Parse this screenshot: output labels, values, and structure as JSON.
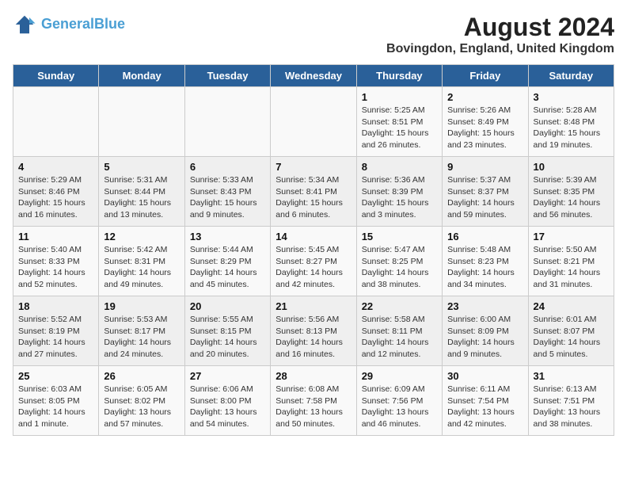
{
  "header": {
    "logo_line1": "General",
    "logo_line2": "Blue",
    "month": "August 2024",
    "location": "Bovingdon, England, United Kingdom"
  },
  "days_of_week": [
    "Sunday",
    "Monday",
    "Tuesday",
    "Wednesday",
    "Thursday",
    "Friday",
    "Saturday"
  ],
  "weeks": [
    [
      {
        "day": "",
        "content": ""
      },
      {
        "day": "",
        "content": ""
      },
      {
        "day": "",
        "content": ""
      },
      {
        "day": "",
        "content": ""
      },
      {
        "day": "1",
        "content": "Sunrise: 5:25 AM\nSunset: 8:51 PM\nDaylight: 15 hours\nand 26 minutes."
      },
      {
        "day": "2",
        "content": "Sunrise: 5:26 AM\nSunset: 8:49 PM\nDaylight: 15 hours\nand 23 minutes."
      },
      {
        "day": "3",
        "content": "Sunrise: 5:28 AM\nSunset: 8:48 PM\nDaylight: 15 hours\nand 19 minutes."
      }
    ],
    [
      {
        "day": "4",
        "content": "Sunrise: 5:29 AM\nSunset: 8:46 PM\nDaylight: 15 hours\nand 16 minutes."
      },
      {
        "day": "5",
        "content": "Sunrise: 5:31 AM\nSunset: 8:44 PM\nDaylight: 15 hours\nand 13 minutes."
      },
      {
        "day": "6",
        "content": "Sunrise: 5:33 AM\nSunset: 8:43 PM\nDaylight: 15 hours\nand 9 minutes."
      },
      {
        "day": "7",
        "content": "Sunrise: 5:34 AM\nSunset: 8:41 PM\nDaylight: 15 hours\nand 6 minutes."
      },
      {
        "day": "8",
        "content": "Sunrise: 5:36 AM\nSunset: 8:39 PM\nDaylight: 15 hours\nand 3 minutes."
      },
      {
        "day": "9",
        "content": "Sunrise: 5:37 AM\nSunset: 8:37 PM\nDaylight: 14 hours\nand 59 minutes."
      },
      {
        "day": "10",
        "content": "Sunrise: 5:39 AM\nSunset: 8:35 PM\nDaylight: 14 hours\nand 56 minutes."
      }
    ],
    [
      {
        "day": "11",
        "content": "Sunrise: 5:40 AM\nSunset: 8:33 PM\nDaylight: 14 hours\nand 52 minutes."
      },
      {
        "day": "12",
        "content": "Sunrise: 5:42 AM\nSunset: 8:31 PM\nDaylight: 14 hours\nand 49 minutes."
      },
      {
        "day": "13",
        "content": "Sunrise: 5:44 AM\nSunset: 8:29 PM\nDaylight: 14 hours\nand 45 minutes."
      },
      {
        "day": "14",
        "content": "Sunrise: 5:45 AM\nSunset: 8:27 PM\nDaylight: 14 hours\nand 42 minutes."
      },
      {
        "day": "15",
        "content": "Sunrise: 5:47 AM\nSunset: 8:25 PM\nDaylight: 14 hours\nand 38 minutes."
      },
      {
        "day": "16",
        "content": "Sunrise: 5:48 AM\nSunset: 8:23 PM\nDaylight: 14 hours\nand 34 minutes."
      },
      {
        "day": "17",
        "content": "Sunrise: 5:50 AM\nSunset: 8:21 PM\nDaylight: 14 hours\nand 31 minutes."
      }
    ],
    [
      {
        "day": "18",
        "content": "Sunrise: 5:52 AM\nSunset: 8:19 PM\nDaylight: 14 hours\nand 27 minutes."
      },
      {
        "day": "19",
        "content": "Sunrise: 5:53 AM\nSunset: 8:17 PM\nDaylight: 14 hours\nand 24 minutes."
      },
      {
        "day": "20",
        "content": "Sunrise: 5:55 AM\nSunset: 8:15 PM\nDaylight: 14 hours\nand 20 minutes."
      },
      {
        "day": "21",
        "content": "Sunrise: 5:56 AM\nSunset: 8:13 PM\nDaylight: 14 hours\nand 16 minutes."
      },
      {
        "day": "22",
        "content": "Sunrise: 5:58 AM\nSunset: 8:11 PM\nDaylight: 14 hours\nand 12 minutes."
      },
      {
        "day": "23",
        "content": "Sunrise: 6:00 AM\nSunset: 8:09 PM\nDaylight: 14 hours\nand 9 minutes."
      },
      {
        "day": "24",
        "content": "Sunrise: 6:01 AM\nSunset: 8:07 PM\nDaylight: 14 hours\nand 5 minutes."
      }
    ],
    [
      {
        "day": "25",
        "content": "Sunrise: 6:03 AM\nSunset: 8:05 PM\nDaylight: 14 hours\nand 1 minute."
      },
      {
        "day": "26",
        "content": "Sunrise: 6:05 AM\nSunset: 8:02 PM\nDaylight: 13 hours\nand 57 minutes."
      },
      {
        "day": "27",
        "content": "Sunrise: 6:06 AM\nSunset: 8:00 PM\nDaylight: 13 hours\nand 54 minutes."
      },
      {
        "day": "28",
        "content": "Sunrise: 6:08 AM\nSunset: 7:58 PM\nDaylight: 13 hours\nand 50 minutes."
      },
      {
        "day": "29",
        "content": "Sunrise: 6:09 AM\nSunset: 7:56 PM\nDaylight: 13 hours\nand 46 minutes."
      },
      {
        "day": "30",
        "content": "Sunrise: 6:11 AM\nSunset: 7:54 PM\nDaylight: 13 hours\nand 42 minutes."
      },
      {
        "day": "31",
        "content": "Sunrise: 6:13 AM\nSunset: 7:51 PM\nDaylight: 13 hours\nand 38 minutes."
      }
    ]
  ]
}
